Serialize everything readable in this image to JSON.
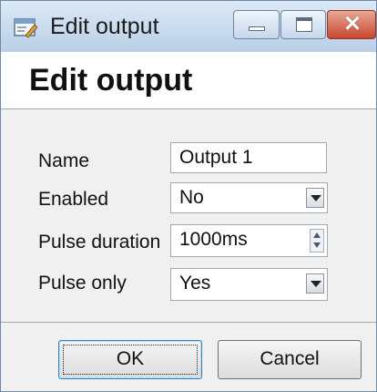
{
  "window": {
    "title": "Edit output"
  },
  "titlebar_icons": {
    "app": "edit-window-icon",
    "minimize": "minimize-icon",
    "maximize": "maximize-icon",
    "close": "close-icon"
  },
  "header": {
    "title": "Edit output"
  },
  "form": {
    "name": {
      "label": "Name",
      "value": "Output 1"
    },
    "enabled": {
      "label": "Enabled",
      "value": "No"
    },
    "pulse_duration": {
      "label": "Pulse duration",
      "value": "1000ms"
    },
    "pulse_only": {
      "label": "Pulse only",
      "value": "Yes"
    }
  },
  "buttons": {
    "ok": "OK",
    "cancel": "Cancel"
  },
  "colors": {
    "titlebar": "#c9dcef",
    "close_button": "#c8462e",
    "ok_focus_border": "#3c7fb1"
  }
}
